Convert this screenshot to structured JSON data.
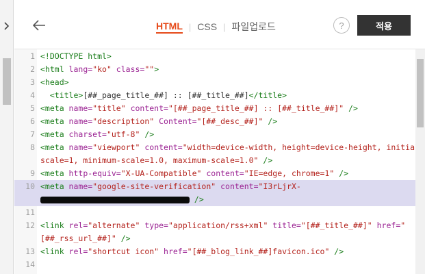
{
  "header": {
    "tabs": [
      {
        "label": "HTML",
        "active": true
      },
      {
        "label": "CSS",
        "active": false
      },
      {
        "label": "파일업로드",
        "active": false
      }
    ],
    "help_label": "?",
    "apply_label": "적용",
    "accent_color": "#e64a19"
  },
  "icons": {
    "expand": "chevron-right-icon",
    "back": "arrow-left-icon",
    "help": "question-circle-icon"
  },
  "editor": {
    "highlighted_line": "10",
    "lines": [
      {
        "num": "1",
        "parts": [
          "<!DOCTYPE html>"
        ]
      },
      {
        "num": "2",
        "parts": [
          "<html",
          " lang=",
          "\"ko\"",
          " class=",
          "\"\"",
          ">"
        ]
      },
      {
        "num": "3",
        "parts": [
          "<head>"
        ]
      },
      {
        "num": "4",
        "parts": [
          "  <title>",
          "[##_page_title_##] :: [##_title_##]",
          "</title>"
        ]
      },
      {
        "num": "5",
        "parts": [
          "<meta",
          " name=",
          "\"title\"",
          " content=",
          "\"[##_page_title_##] :: [##_title_##]\"",
          " />"
        ]
      },
      {
        "num": "6",
        "parts": [
          "<meta",
          " name=",
          "\"description\"",
          " Content=",
          "\"[##_desc_##]\"",
          " />"
        ]
      },
      {
        "num": "7",
        "parts": [
          "<meta",
          " charset=",
          "\"utf-8\"",
          " />"
        ]
      },
      {
        "num": "8",
        "parts": [
          "<meta",
          " name=",
          "\"viewport\"",
          " content=",
          "\"width=device-width, height=device-height, initial-",
          "scale=1, minimum-scale=1.0, maximum-scale=1.0\"",
          " />"
        ]
      },
      {
        "num": "9",
        "parts": [
          "<meta",
          " http-equiv=",
          "\"X-UA-Compatible\"",
          " content=",
          "\"IE=edge, chrome=1\"",
          " />"
        ]
      },
      {
        "num": "10",
        "parts": [
          "<meta",
          " name=",
          "\"google-site-verification\"",
          " content=",
          "\"I3rLjrX-",
          " />"
        ]
      },
      {
        "num": "11",
        "parts": []
      },
      {
        "num": "12",
        "parts": [
          "<link",
          " rel=",
          "\"alternate\"",
          " type=",
          "\"application/rss+xml\"",
          " title=",
          "\"[##_title_##]\"",
          " href=",
          "\"",
          "[##_rss_url_##]\"",
          " />"
        ]
      },
      {
        "num": "13",
        "parts": [
          "<link",
          " rel=",
          "\"shortcut icon\"",
          " href=",
          "\"[##_blog_link_##]favicon.ico\"",
          " />"
        ]
      },
      {
        "num": "14",
        "parts": []
      }
    ]
  }
}
